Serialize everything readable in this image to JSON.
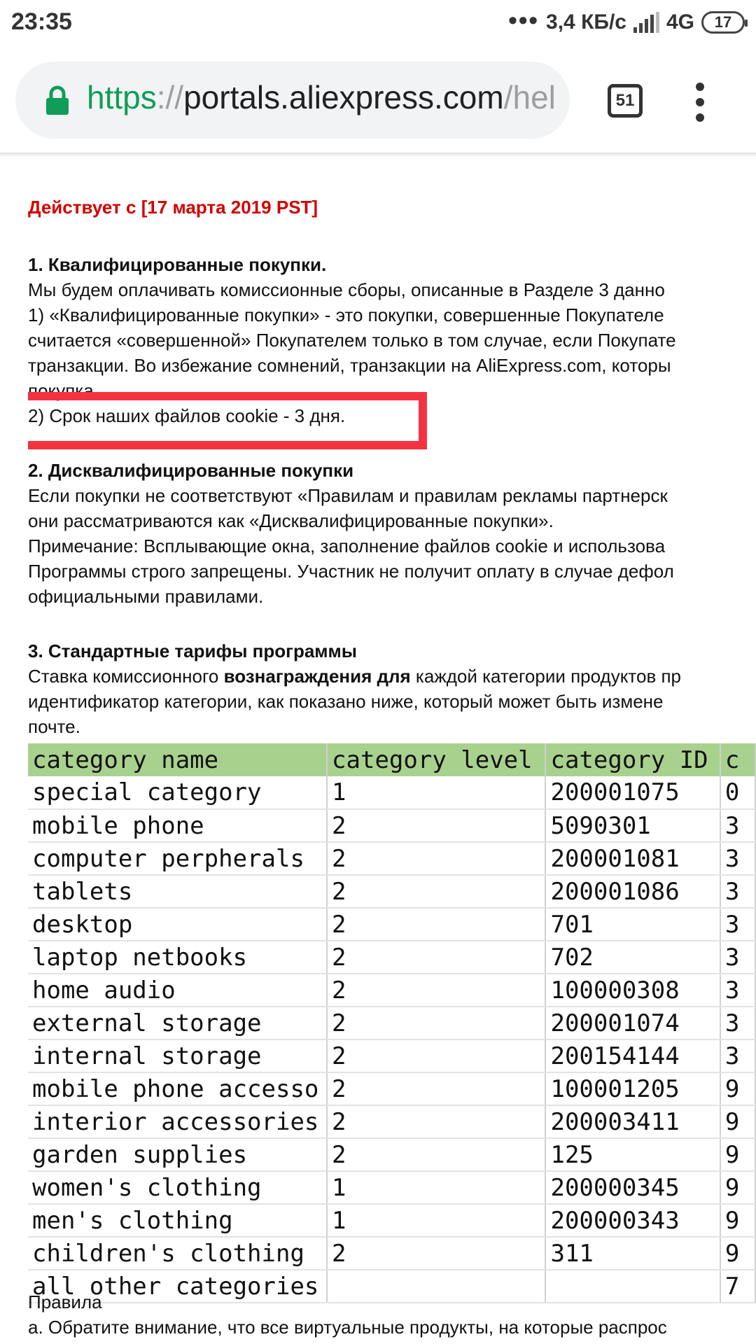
{
  "status_bar": {
    "time": "23:35",
    "dots": "•••",
    "speed": "3,4 КБ/с",
    "network": "4G",
    "battery": "17"
  },
  "browser": {
    "url_scheme": "https",
    "url_sep": "://",
    "url_host": "portals.aliexpress.com",
    "url_rest": "/hel",
    "tab_count": "51"
  },
  "doc": {
    "effective": "Действует с [17 марта 2019 PST]",
    "s1_title": "1. Квалифицированные покупки.",
    "s1_l1": "Мы будем оплачивать комиссионные сборы, описанные в Разделе 3 данно",
    "s1_l2": "1) «Квалифицированные покупки» - это покупки, совершенные Покупателе",
    "s1_l3": "считается «совершенной» Покупателем только в том случае, если Покупате",
    "s1_l4": "транзакции. Во избежание сомнений, транзакции на AliExpress.com, которы",
    "s1_l5": "покупка.",
    "s1_l6": "2) Срок наших файлов cookie - 3 дня.",
    "s2_title": "2. Дисквалифицированные покупки",
    "s2_l1": "Если покупки не соответствуют «Правилам и правилам рекламы партнерск",
    "s2_l2": "они рассматриваются как «Дисквалифицированные покупки».",
    "s2_l3": "Примечание: Всплывающие окна, заполнение файлов cookie и использова",
    "s2_l4": "Программы строго запрещены. Участник не получит оплату в случае дефол",
    "s2_l5": "официальными правилами.",
    "s3_title": "3. Стандартные тарифы программы",
    "s3_l1_pre": "Ставка комиссионного ",
    "s3_l1_bold": "вознаграждения для",
    "s3_l1_post": " каждой категории продуктов пр",
    "s3_l2": "идентификатор категории, как показано ниже, который может быть измене",
    "s3_l3": "почте.",
    "after_1": "Правила",
    "after_2": "a. Обратите внимание, что все виртуальные продукты, на которые распрос"
  },
  "table": {
    "headers": [
      "category name",
      "category level",
      "category ID",
      "c"
    ],
    "rows": [
      [
        "special category",
        "1",
        "200001075",
        "0"
      ],
      [
        "mobile phone",
        "2",
        "5090301",
        "3"
      ],
      [
        "computer perpherals",
        "2",
        "200001081",
        "3"
      ],
      [
        "tablets",
        "2",
        "200001086",
        "3"
      ],
      [
        "desktop",
        "2",
        "701",
        "3"
      ],
      [
        "laptop netbooks",
        "2",
        "702",
        "3"
      ],
      [
        "home audio",
        "2",
        "100000308",
        "3"
      ],
      [
        "external storage",
        "2",
        "200001074",
        "3"
      ],
      [
        "internal storage",
        "2",
        "200154144",
        "3"
      ],
      [
        "mobile phone accesso",
        "2",
        "100001205",
        "9"
      ],
      [
        "interior accessories",
        "2",
        "200003411",
        "9"
      ],
      [
        "garden supplies",
        "2",
        "125",
        "9"
      ],
      [
        "women's clothing",
        "1",
        "200000345",
        "9"
      ],
      [
        "men's clothing",
        "1",
        "200000343",
        "9"
      ],
      [
        "children's clothing",
        "2",
        "311",
        "9"
      ],
      [
        "all other categories",
        "",
        "",
        "7"
      ]
    ]
  },
  "colors": {
    "highlight_box": "#f43341",
    "effective_text": "#d40000",
    "table_header": "#a9d18e",
    "url_scheme": "#0f9d58"
  },
  "icons": [
    "lock-icon",
    "tabs-count-icon",
    "overflow-menu-icon",
    "signal-icon",
    "battery-icon"
  ]
}
